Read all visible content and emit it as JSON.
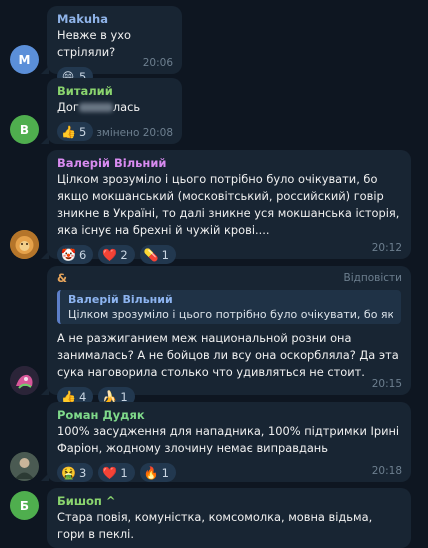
{
  "messages": [
    {
      "author": "Makuha",
      "author_color": "#8fb3e8",
      "avatar_letter": "M",
      "avatar_color": "#5b8fd9",
      "text": "Невже в ухо стріляли?",
      "reactions": [
        {
          "emoji": "😁",
          "count": "5"
        }
      ],
      "time": "20:06"
    },
    {
      "author": "Виталий",
      "author_color": "#8ad46e",
      "avatar_letter": "В",
      "avatar_color": "#4fae4e",
      "text_start": "Дог",
      "text_end": "лась",
      "reactions": [
        {
          "emoji": "👍",
          "count": "5"
        }
      ],
      "edited": "змінено",
      "time": "20:08"
    },
    {
      "author": "Валерій Вільний",
      "author_color": "#d88bf0",
      "avatar_kind": "lion-image",
      "text": "Цілком зрозуміло і цього потрібно було очікувати, бо якщо мокшанський (московітський, российский) говір зникне в Україні, то далі зникне уся мокшанська історія, яка існує на брехні й чужій крові....",
      "reactions": [
        {
          "emoji": "🤡",
          "count": "6"
        },
        {
          "emoji": "❤️",
          "count": "2"
        },
        {
          "emoji": "💊",
          "count": "1"
        }
      ],
      "time": "20:12"
    },
    {
      "author": "&",
      "author_color": "#e7a55c",
      "avatar_kind": "pink-image",
      "reply_label": "Відповісти",
      "quote_author": "Валерій Вільний",
      "quote_text": "Цілком зрозуміло і цього потрібно було очікувати, бо якщо ...",
      "text": "А не разжиганием меж национальной розни она занималась? А не бойцов ли всу она оскорбляла? Да эта сука наговорила столько что удивляться не стоит.",
      "reactions": [
        {
          "emoji": "👍",
          "count": "4"
        },
        {
          "emoji": "🍌",
          "count": "1"
        }
      ],
      "time": "20:15"
    },
    {
      "author": "Роман Дудяк",
      "author_color": "#7fd98a",
      "avatar_kind": "person-image",
      "text": "100% засудження для нападника, 100% підтримки Ірині Фаріон, жодному злочину немає виправдань",
      "reactions": [
        {
          "emoji": "🤮",
          "count": "3"
        },
        {
          "emoji": "❤️",
          "count": "1"
        },
        {
          "emoji": "🔥",
          "count": "1"
        }
      ],
      "time": "20:18"
    },
    {
      "author": "Бишоп ^",
      "author_color": "#8ad46e",
      "avatar_letter": "Б",
      "avatar_color": "#4fae4e",
      "text": "Стара повія, комуністка, комсомолка, мовна відьма, гори в пеклі."
    }
  ]
}
